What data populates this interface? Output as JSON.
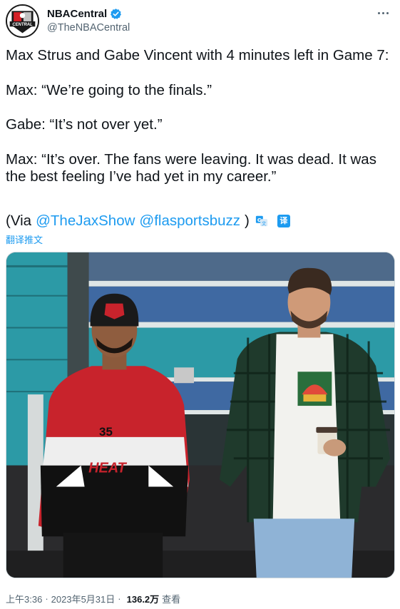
{
  "account": {
    "display_name": "NBACentral",
    "handle": "@TheNBACentral",
    "avatar_text": "CENTRAL",
    "verified": true
  },
  "tweet": {
    "paragraphs": [
      "Max Strus and Gabe Vincent with 4 minutes left in Game 7:",
      "Max: “We’re going to the finals.”",
      "Gabe: “It’s not over yet.”",
      "Max: “It’s over. The fans were leaving. It was dead. It was the best feeling I’ve had yet in my career.”"
    ],
    "via_prefix": "(Via",
    "mentions": [
      "@TheJaxShow",
      "@flasportsbuzz"
    ],
    "via_suffix": ")",
    "translate_badge": "译",
    "translate_label": "翻译推文"
  },
  "photo": {
    "jersey_number": "35",
    "jersey_text": "HEAT"
  },
  "meta": {
    "time": "上午3:36",
    "separator": "·",
    "date": "2023年5月31日",
    "views_count": "136.2万",
    "views_label": "查看"
  },
  "colors": {
    "link": "#1d9bf0",
    "text": "#0f1419",
    "secondary": "#536471",
    "teal_wall": "#2e9aa6"
  }
}
